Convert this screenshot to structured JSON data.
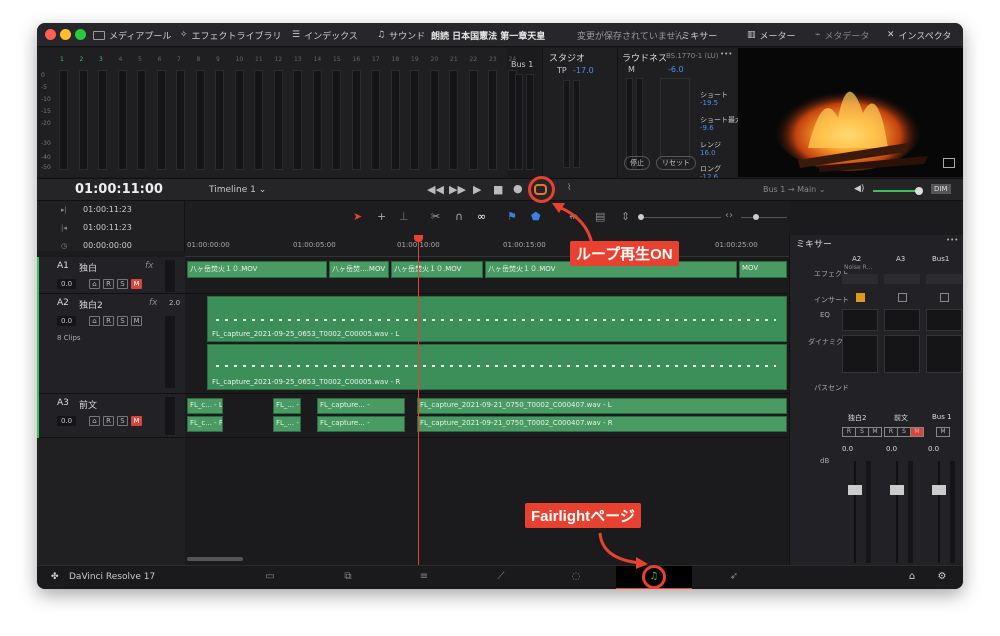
{
  "window": {
    "title": "朗読 日本国憲法 第一章天皇",
    "title_status": "変更が保存されていません"
  },
  "topbar": {
    "items": [
      "メディアプール",
      "エフェクトライブラリ",
      "インデックス",
      "サウンド"
    ],
    "right_items": [
      "ミキサー",
      "メーター",
      "メタデータ",
      "インスペクタ"
    ]
  },
  "meters": {
    "channel_numbers": [
      "1",
      "2",
      "3",
      "4",
      "5",
      "6",
      "7",
      "8",
      "9",
      "10",
      "11",
      "12",
      "13",
      "14",
      "15",
      "16",
      "17",
      "18",
      "19",
      "20",
      "21",
      "22",
      "23",
      "24"
    ],
    "scale": [
      "0",
      "-5",
      "-10",
      "-15",
      "-20",
      "-30",
      "-40",
      "-50"
    ],
    "bus_label": "Bus 1"
  },
  "studio": {
    "title": "スタジオ",
    "tp_label": "TP",
    "tp_value": "-17.0"
  },
  "loudness": {
    "title": "ラウドネス",
    "standard": "BS.1770-1 (LU)",
    "m_label": "M",
    "m_value": "-6.0",
    "short_label": "ショート",
    "short_value": "-19.5",
    "short_max_label": "ショート最大",
    "short_max_value": "-9.6",
    "range_label": "レンジ",
    "range_value": "16.0",
    "long_label": "ロング",
    "long_value": "-12.6",
    "stop_label": "停止",
    "reset_label": "リセット"
  },
  "transport": {
    "timecode": "01:00:11:00",
    "timeline_name": "Timeline 1",
    "route_from": "Bus 1",
    "route_to": "Main",
    "dim_label": "DIM"
  },
  "timecodes": {
    "in": "01:00:11:23",
    "out": "01:00:11:23",
    "duration": "00:00:00:00"
  },
  "ruler": [
    "01:00:00:00",
    "01:00:05:00",
    "01:00:10:00",
    "01:00:15:00",
    "01:00:25:00"
  ],
  "tracks": [
    {
      "id": "A1",
      "name": "独白",
      "level": "0.0",
      "fx": "fx"
    },
    {
      "id": "A2",
      "name": "独白2",
      "level": "0.0",
      "fx": "fx",
      "extra": "2.0",
      "clips_count": "8 Clips"
    },
    {
      "id": "A3",
      "name": "前文",
      "level": "0.0"
    }
  ],
  "buttons": {
    "r": "R",
    "s": "S",
    "m": "M"
  },
  "clips": {
    "a1": [
      "八ヶ岳焚火１０.MOV",
      "八ヶ岳焚....MOV",
      "八ヶ岳焚火１０.MOV",
      "八ヶ岳焚火１０.MOV",
      "MOV"
    ],
    "a2_l": "FL_capture_2021-09-25_0653_T0002_C00005.wav - L",
    "a2_r": "FL_capture_2021-09-25_0653_T0002_C00005.wav - R",
    "a3_l": [
      "FL_c... - L",
      "FL_... - L",
      "FL_capture... -",
      "FL_capture_2021-09-21_0750_T0002_C000407.wav - L"
    ],
    "a3_r": [
      "FL_c... - R",
      "FL_... - R",
      "FL_capture... -",
      "FL_capture_2021-09-21_0750_T0002_C000407.wav - R"
    ]
  },
  "mixer": {
    "title": "ミキサー",
    "channels": [
      "A2",
      "A3",
      "Bus1"
    ],
    "a2_sub": "Noise R...",
    "row_labels": [
      "エフェクト",
      "インサート",
      "EQ",
      "ダイナミクス",
      "パスセンド"
    ],
    "strip_names": [
      "独白2",
      "前文",
      "Bus 1"
    ],
    "db_label": "dB",
    "db_values": [
      "0.0",
      "0.0",
      "0.0"
    ]
  },
  "bottom": {
    "app_name": "DaVinci Resolve 17"
  },
  "annotations": {
    "loop": "ループ再生ON",
    "fairlight": "Fairlightページ"
  },
  "colors": {
    "accent_red": "#e8412f",
    "clip_green": "#4a9a63",
    "playhead": "#e8412f"
  }
}
